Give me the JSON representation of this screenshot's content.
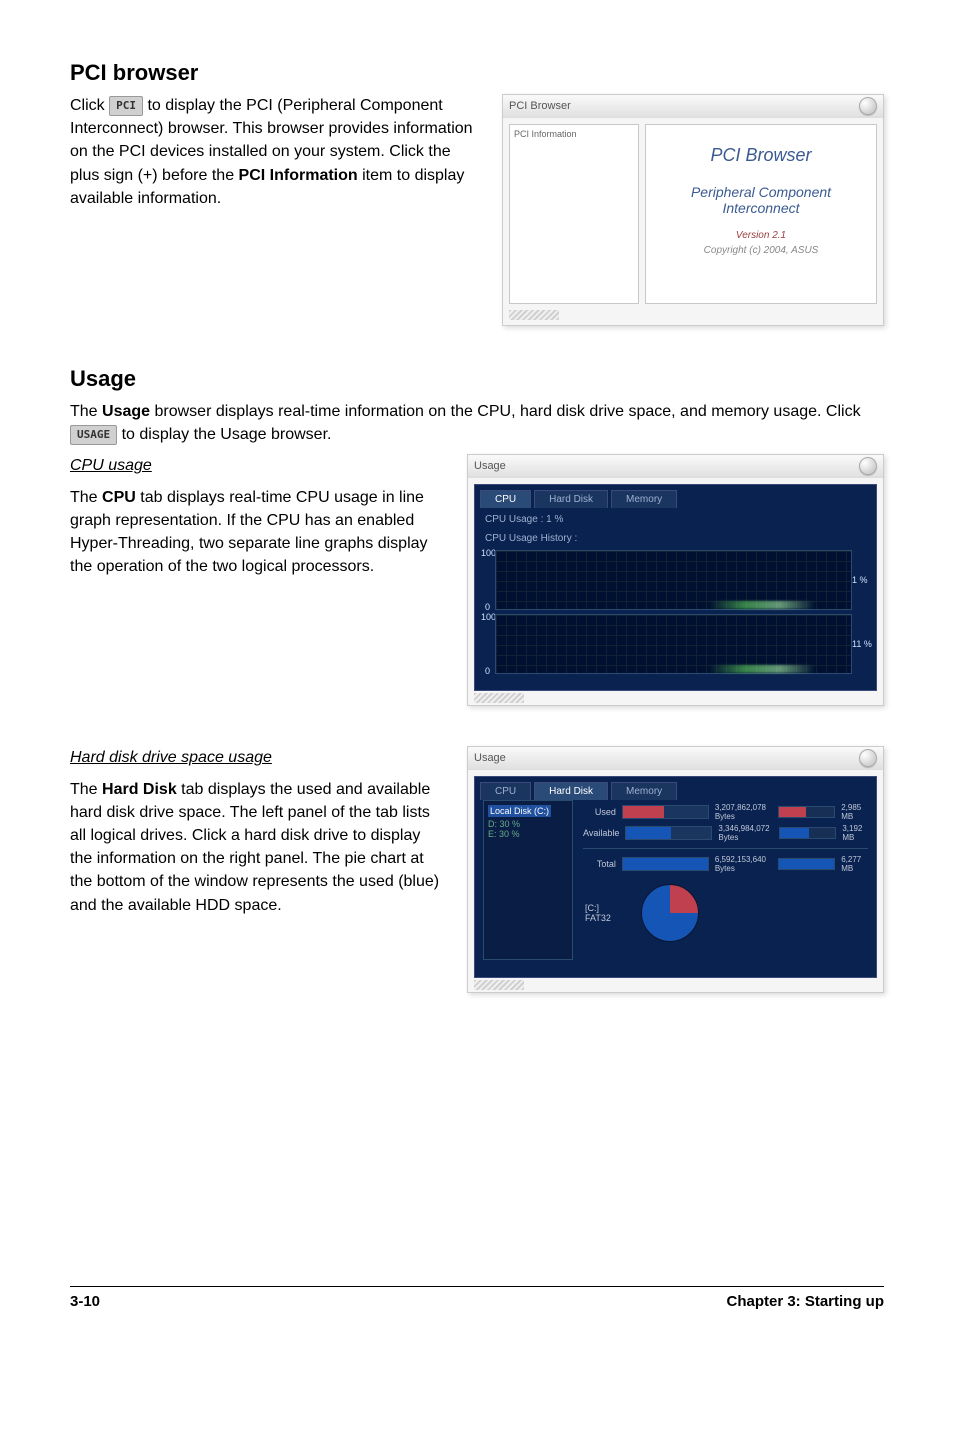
{
  "pci": {
    "heading": "PCI browser",
    "body1": "Click ",
    "btn": "PCI",
    "body2": " to display the PCI (Peripheral Component Interconnect) browser. This browser provides information on the PCI devices installed on your system. Click the plus sign (+) before the ",
    "bold1": "PCI Information",
    "body3": " item to display available information.",
    "shot": {
      "title": "PCI Browser",
      "tree": "PCI Information",
      "r1": "PCI Browser",
      "r2a": "Peripheral Component",
      "r2b": "Interconnect",
      "r3": "Version 2.1",
      "r4": "Copyright (c) 2004, ASUS"
    }
  },
  "usage": {
    "heading": "Usage",
    "intro1": "The ",
    "introBold": "Usage",
    "intro2": " browser displays real-time information on the CPU, hard disk drive space, and memory usage. Click ",
    "btn": "USAGE",
    "intro3": " to display the Usage browser.",
    "cpu": {
      "title": "CPU usage",
      "body1": "The ",
      "bold": "CPU",
      "body2": " tab displays real-time CPU usage in line graph representation. If the CPU has an enabled Hyper-Threading, two separate line graphs display the operation of the two logical processors."
    },
    "cpuShot": {
      "title": "Usage",
      "tabCPU": "CPU",
      "tabHDD": "Hard Disk",
      "tabMem": "Memory",
      "usageLabel": "CPU Usage :     1 %",
      "historyLabel": "CPU Usage History :",
      "scale100": "100",
      "scale0": "0",
      "pct1": "1 %",
      "pct2": "11 %"
    },
    "hdd": {
      "title": "Hard disk drive space usage",
      "body1": "The ",
      "bold": "Hard Disk",
      "body2": " tab displays the used and available hard disk drive space. The left panel of the tab lists all logical drives. Click a hard disk drive to display the information on the right panel. The pie chart at the bottom of the window represents the used (blue) and the available HDD space."
    },
    "hddShot": {
      "title": "Usage",
      "drive": "Local Disk (C:)",
      "drv2": "D: 30 %",
      "drv3": "E: 30 %",
      "usedLabel": "Used",
      "usedBar": "3,207,862,078 Bytes",
      "usedGB": "2,985 MB",
      "availLabel": "Available",
      "availBar": "3,346,984,072 Bytes",
      "availGB": "3,192 MB",
      "totalLabel": "Total",
      "totalBar": "6,592,153,640 Bytes",
      "totalGB": "6,277 MB",
      "driveC": "[C:]",
      "fs": "FAT32"
    }
  },
  "footer": {
    "left": "3-10",
    "right": "Chapter 3: Starting up"
  }
}
